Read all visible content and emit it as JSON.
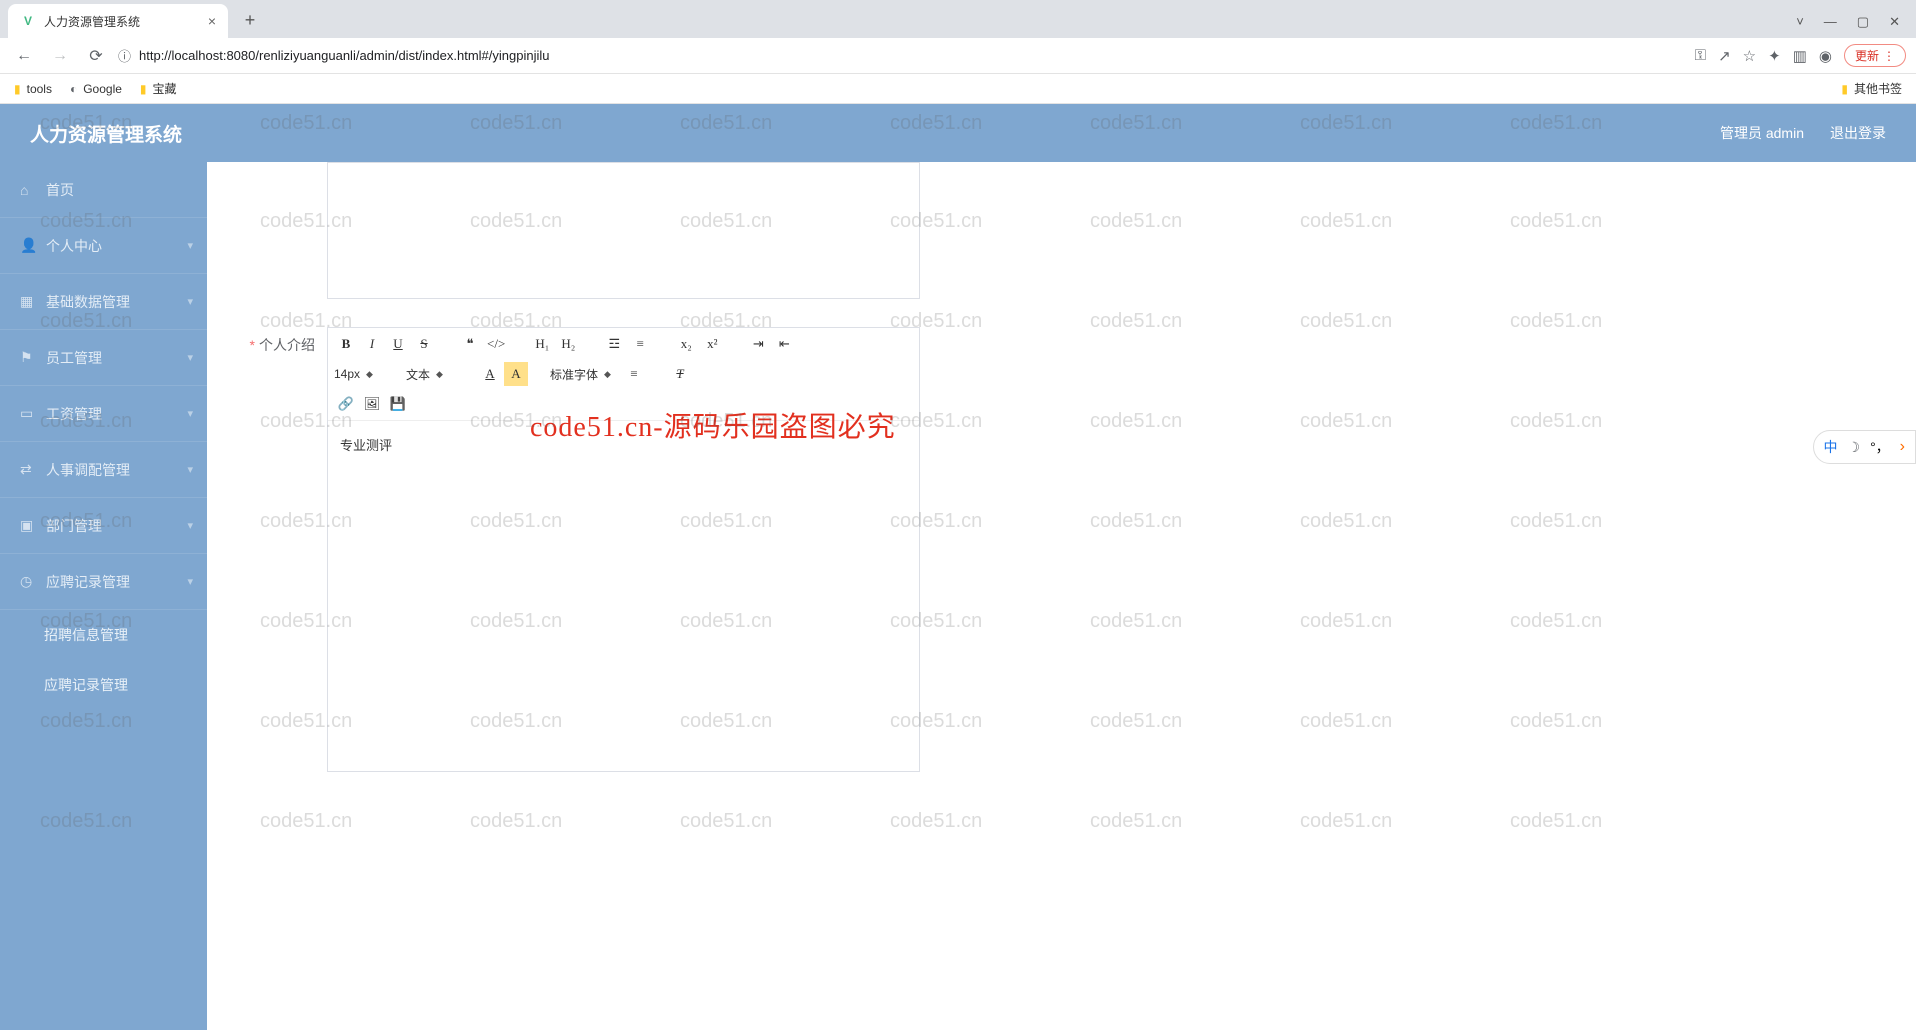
{
  "browser": {
    "tab_title": "人力资源管理系统",
    "url": "http://localhost:8080/renliziyuanguanli/admin/dist/index.html#/yingpinjilu",
    "update_label": "更新",
    "bookmarks": {
      "tools": "tools",
      "google": "Google",
      "baozang": "宝藏",
      "other": "其他书签"
    }
  },
  "app": {
    "title": "人力资源管理系统",
    "user_label": "管理员 admin",
    "logout": "退出登录"
  },
  "sidebar": {
    "items": [
      {
        "icon": "home-icon",
        "label": "首页"
      },
      {
        "icon": "user-icon",
        "label": "个人中心"
      },
      {
        "icon": "grid-icon",
        "label": "基础数据管理"
      },
      {
        "icon": "staff-icon",
        "label": "员工管理"
      },
      {
        "icon": "salary-icon",
        "label": "工资管理"
      },
      {
        "icon": "transfer-icon",
        "label": "人事调配管理"
      },
      {
        "icon": "dept-icon",
        "label": "部门管理"
      },
      {
        "icon": "record-icon",
        "label": "应聘记录管理"
      }
    ],
    "sub": [
      "招聘信息管理",
      "应聘记录管理"
    ]
  },
  "form": {
    "intro_label": "个人介绍",
    "editor": {
      "font_size": "14px",
      "block": "文本",
      "font_family": "标准字体",
      "content": "专业测评"
    }
  },
  "ime": {
    "lang": "中",
    "comma": "°，"
  },
  "watermark_text": "code51.cn",
  "watermark_red": "code51.cn-源码乐园盗图必究"
}
